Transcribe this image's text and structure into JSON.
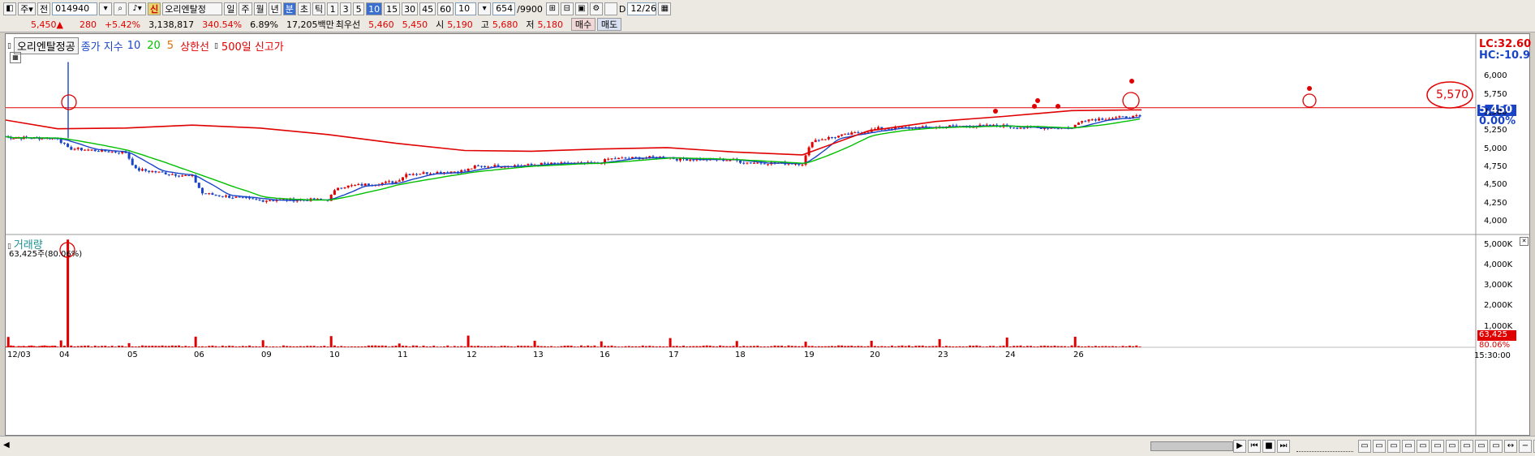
{
  "toolbar": {
    "stock_code": "014940",
    "stock_name": "오리엔탈정",
    "new_badge": "신",
    "period_buttons": [
      "일",
      "주",
      "월",
      "년",
      "분",
      "초",
      "틱"
    ],
    "minute_buttons": [
      "1",
      "3",
      "5",
      "10",
      "15",
      "30",
      "45",
      "60"
    ],
    "selected_minute": "10",
    "interval_value": "10",
    "bar_count": "654",
    "bar_total": "/9900",
    "date_value": "12/26",
    "market_label": "주",
    "prev_label": "전"
  },
  "quote": {
    "price": "5,450▲",
    "change": "280",
    "change_pct": "+5.42%",
    "volume": "3,138,817",
    "volume_ratio": "340.54%",
    "turnover": "6.89%",
    "trade_amount": "17,205백만",
    "best_ask_label": "최우선",
    "best_ask": "5,460",
    "best_bid": "5,450",
    "open_label": "시",
    "open": "5,190",
    "high_label": "고",
    "high": "5,680",
    "low_label": "저",
    "low": "5,180",
    "buy_button": "매수",
    "sell_button": "매도"
  },
  "legend": {
    "name": "오리엔탈정공",
    "close_label": "종가 지수",
    "ma10": "10",
    "ma20": "20",
    "ma5": "5",
    "upper_label": "상한선",
    "high500": "500일 신고가"
  },
  "chart_labels": {
    "lc": "LC:32.60",
    "hc": "HC:-10.9",
    "circled_price": "5,570",
    "current_price": "5,450",
    "current_change": "0.00%",
    "volume_title": "거래량",
    "volume_note": "63,425주(80.06%)",
    "current_volume": "63,425",
    "current_volume_pct": "80.06%",
    "price_ticks": [
      "6,000",
      "5,750",
      "5,500",
      "5,250",
      "5,000",
      "4,750",
      "4,500",
      "4,250",
      "4,000"
    ],
    "volume_ticks": [
      "5,000K",
      "4,000K",
      "3,000K",
      "2,000K",
      "1,000K"
    ],
    "date_ticks": [
      "12/03",
      "04",
      "05",
      "06",
      "09",
      "10",
      "11",
      "12",
      "13",
      "16",
      "17",
      "18",
      "19",
      "20",
      "23",
      "24",
      "26"
    ],
    "time_label": "15:30:00"
  },
  "colors": {
    "up": "#e00000",
    "down": "#1a44c8",
    "ma5": "#e00000",
    "ma10": "#1a44c8",
    "ma20": "#00c000",
    "ma_long": "#e00000"
  },
  "chart_data": {
    "type": "line",
    "price_axis_range": [
      3900,
      6250
    ],
    "volume_axis_range": [
      0,
      5300000
    ],
    "resistance_level": 5570,
    "trading_days": [
      "12/03",
      "12/04",
      "12/05",
      "12/06",
      "12/09",
      "12/10",
      "12/11",
      "12/12",
      "12/13",
      "12/16",
      "12/17",
      "12/18",
      "12/19",
      "12/20",
      "12/23",
      "12/24",
      "12/26"
    ],
    "close_by_day_approx": [
      5150,
      4950,
      4620,
      4290,
      4300,
      4550,
      4700,
      4780,
      4800,
      4890,
      4850,
      4800,
      5250,
      5300,
      5320,
      5290,
      5450
    ],
    "long_ma_by_day_approx": [
      5400,
      5280,
      5290,
      5330,
      5290,
      5200,
      5080,
      4980,
      4970,
      5000,
      5020,
      4960,
      4920,
      5250,
      5380,
      5450,
      5530
    ]
  }
}
